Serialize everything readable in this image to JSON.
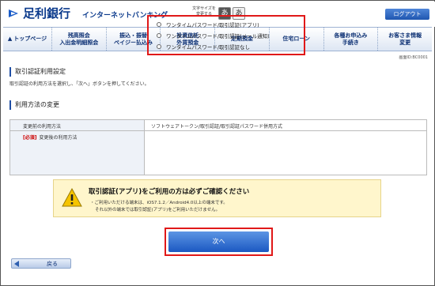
{
  "header": {
    "bank_name": "足利銀行",
    "bank_sub": "インターネットバンキング",
    "fontsize_label": "文字サイズを変更する",
    "fontsize_small": "あ",
    "fontsize_large": "あ",
    "logout_label": "ログアウト"
  },
  "nav": {
    "items": [
      {
        "label": "トップページ"
      },
      {
        "label": "残高照会\n入出金明細照会"
      },
      {
        "label": "振込・振替\nペイジー払込み"
      },
      {
        "label": "投資信託\n外貨預金"
      },
      {
        "label": "定期預金"
      },
      {
        "label": "住宅ローン"
      },
      {
        "label": "各種お申込み\n手続き"
      },
      {
        "label": "お客さま情報\n変更"
      }
    ]
  },
  "screen_id": "画面ID:BC0001",
  "page": {
    "title": "取引認証利用設定",
    "description": "取引認証の利用方法を選択し、「次へ」ボタンを押してください。",
    "section_title": "利用方法の変更"
  },
  "table": {
    "current_label": "変更前の利用方法",
    "current_value": "ソフトウェアトークン/取引認証/取引認証パスワード併用方式",
    "required_badge": "[必須]",
    "new_label": "変更後の利用方法",
    "options": [
      "ワンタイムパスワード/取引認証(アプリ)",
      "ワンタイムパスワード/取引認証(メール通知)",
      "ワンタイムパスワード/取引認証なし"
    ]
  },
  "notice": {
    "title": "取引認証(アプリ)をご利用の方は必ずご確認ください",
    "line1": "・ご利用いただける端末は、iOS7.1.2／Android4.0以上の端末です。",
    "line2": "それ以外の端末では取引認証(アプリ)をご利用いただけません。"
  },
  "buttons": {
    "next_label": "次へ",
    "back_label": "戻る"
  },
  "colors": {
    "brand_blue": "#0b3a8c",
    "highlight_red": "#e01818",
    "notice_bg": "#fff6cc"
  }
}
